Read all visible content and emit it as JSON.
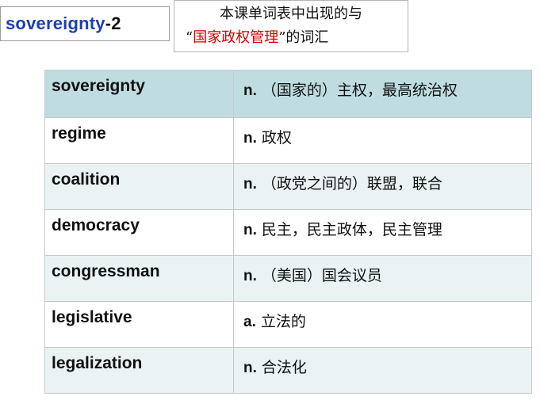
{
  "title": {
    "word": "sovereignty",
    "suffix": "-2"
  },
  "subtitle": {
    "line1": "本课单词表中出现的与",
    "line2_open": "“",
    "line2_highlight": "国家政权管理",
    "line2_close": "”的词汇"
  },
  "colors": {
    "title_blue": "#1f3fb0",
    "highlight_red": "#d40000",
    "header_row": "#bfdde0",
    "alt_row": "#eaf2f4"
  },
  "rows": [
    {
      "word": "sovereignty",
      "pos": "n.",
      "meaning": "（国家的）主权，最高统治权"
    },
    {
      "word": "regime",
      "pos": "n.",
      "meaning": "政权"
    },
    {
      "word": "coalition",
      "pos": "n.",
      "meaning": "（政党之间的）联盟，联合"
    },
    {
      "word": "democracy",
      "pos": "n.",
      "meaning": "民主，民主政体，民主管理"
    },
    {
      "word": "congressman",
      "pos": "n.",
      "meaning": "（美国）国会议员"
    },
    {
      "word": "legislative",
      "pos": "a.",
      "meaning": "立法的"
    },
    {
      "word": "legalization",
      "pos": "n.",
      "meaning": "合法化"
    }
  ]
}
